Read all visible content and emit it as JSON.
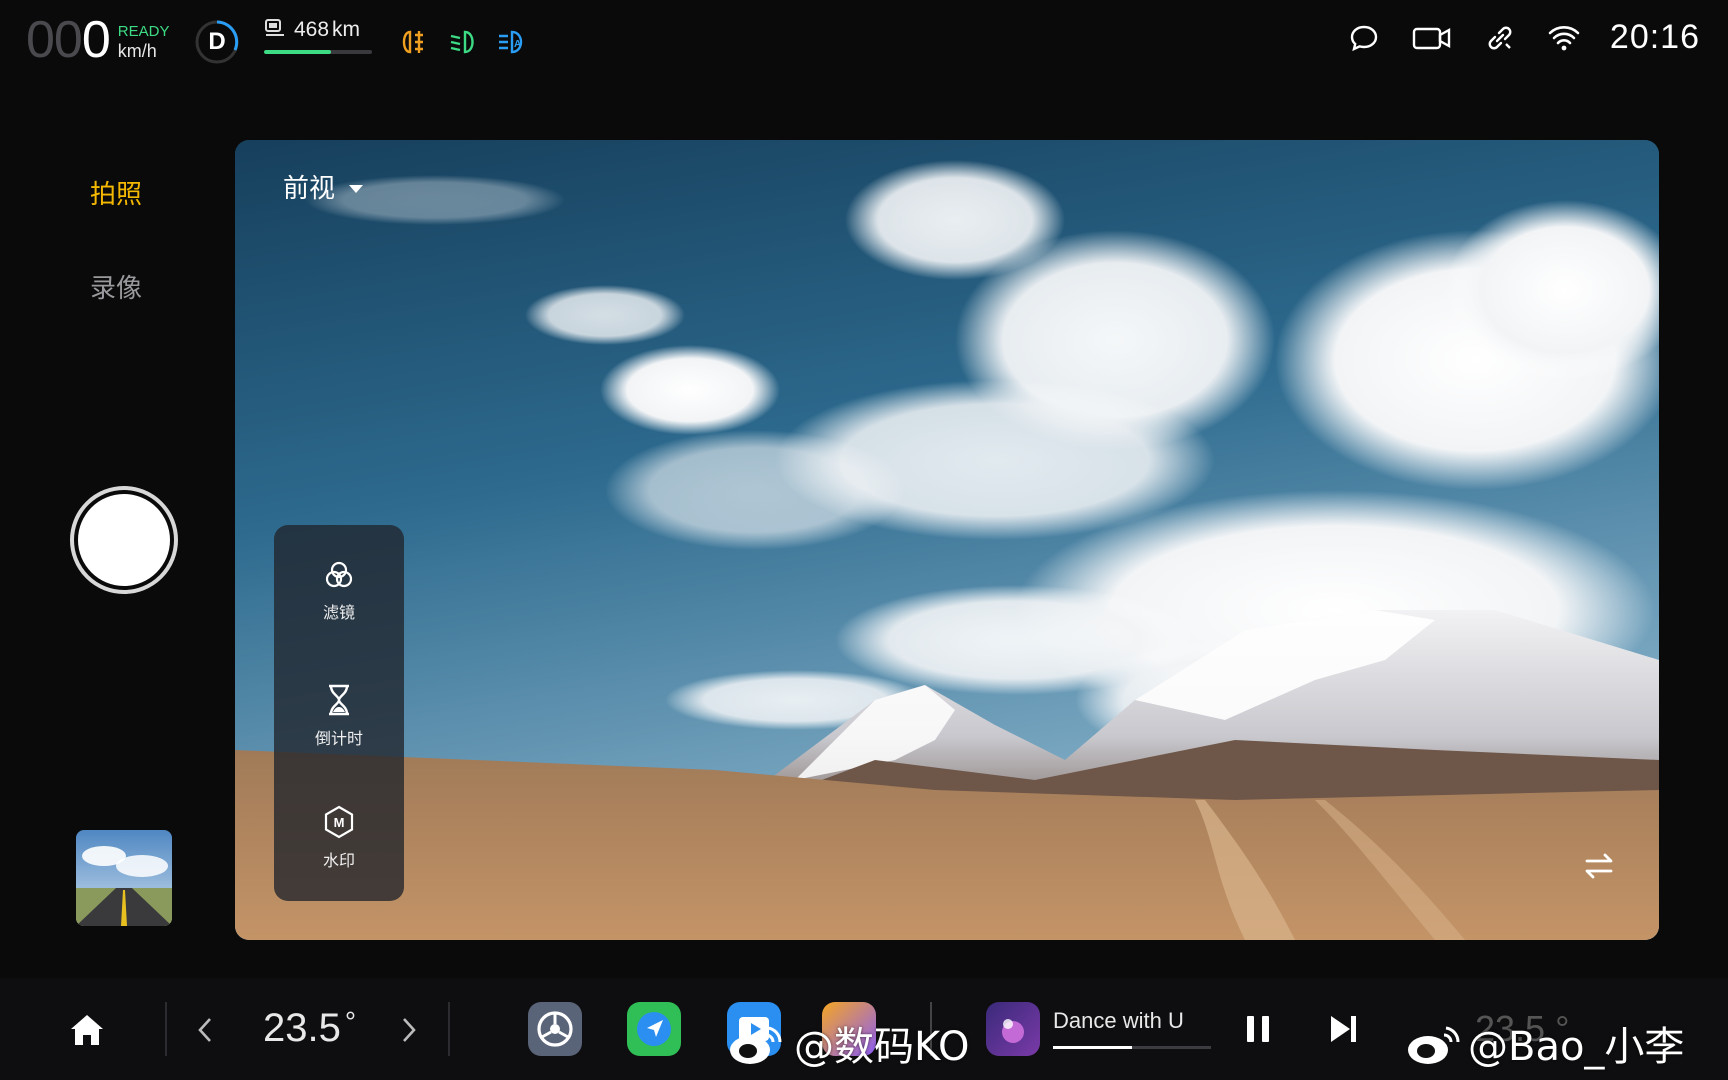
{
  "status": {
    "speed_dim": "00",
    "speed_lit": "0",
    "ready": "READY",
    "speed_unit": "km/h",
    "gear": "D",
    "range_value": "468",
    "range_unit": "km",
    "range_fraction": 0.62,
    "clock": "20:16"
  },
  "colors": {
    "accent": "#f5b800",
    "ready_green": "#3ddc84",
    "lamp_orange": "#f0a020",
    "lamp_green": "#3ddc84",
    "lamp_blue": "#2a9df4"
  },
  "modes": {
    "photo": "拍照",
    "video": "录像"
  },
  "camera": {
    "view_label": "前视",
    "tools": {
      "filter": "滤镜",
      "timer": "倒计时",
      "watermark": "水印"
    }
  },
  "dock": {
    "temp_left": "23.5",
    "temp_unit": "°",
    "song_title": "Dance with U",
    "song_progress": 0.5,
    "watermark_left": "@数码KO",
    "watermark_right": "@Bao_小李",
    "temp_right_ghost": "23.5 °"
  },
  "icons": [
    "home-icon",
    "chevron-left-icon",
    "chevron-right-icon",
    "settings-app-icon",
    "navigation-app-icon",
    "weibo-icon",
    "music-app-icon",
    "pause-icon",
    "next-track-icon",
    "message-icon",
    "camera-icon",
    "link-icon",
    "wifi-icon",
    "fog-lamp-icon",
    "low-beam-icon",
    "auto-beam-icon",
    "filter-icon",
    "hourglass-icon",
    "watermark-icon",
    "swap-camera-icon",
    "battery-range-icon"
  ]
}
